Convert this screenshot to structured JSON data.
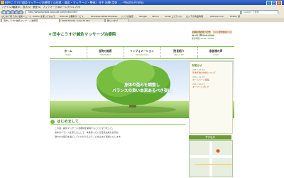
{
  "browser": {
    "title": "田中こうすけ鍼灸マッサージ治療院 | 山形県・鍼灸・マッサージ・整体 | 日中 治療 定休 ... - Mozilla Firefox",
    "menu": [
      "ファイル(F)",
      "編集(E)",
      "表示(V)",
      "履歴(S)",
      "ブックマーク(B)",
      "ツール(T)",
      "ヘルプ(H)"
    ],
    "url": "http://www.tanaka-kousuke.com/index.html",
    "search_placeholder": "Google で検索",
    "bookmarks": [
      "はじめて使う方に",
      "最新ニュース",
      "Firefox を使ってみよう",
      "Hotmail の無料サービス",
      "Windows Media",
      "Windows",
      "リンクの設定",
      "Google",
      "Yahoo!",
      "Sonet 上でサイト",
      "ロシアの商品情報",
      "Outlook.com",
      "Firefox 旅"
    ],
    "tabs": [
      "田中こうすけ鍼灸マッサージ治療院",
      "1000 Stories - Love To Win",
      "新しいタブ"
    ]
  },
  "site": {
    "logo": "田中こうすけ鍼灸マッサージ治療院",
    "contact_button": "お問い合わせ・ご予約",
    "access_button": "アクセス",
    "phone": "☎ 0123-000-0000",
    "hours": "受付時間 10:00〜20:00"
  },
  "nav": [
    {
      "ja": "ホーム",
      "en": "HOME"
    },
    {
      "ja": "当院の施術",
      "en": "TREATMENT"
    },
    {
      "ja": "インフォメーション",
      "en": "INFORMATION"
    },
    {
      "ja": "院長紹介",
      "en": "ABOUT ME"
    },
    {
      "ja": "患者様の声",
      "en": "VOICE"
    }
  ],
  "hero": {
    "caption_line1": "身体の歪みを調整し",
    "caption_line2": "バランスの良い本来あるべき姿に"
  },
  "sidebar": {
    "heading": "お知らせ",
    "items": [
      {
        "date": "2012.01.22",
        "title": "年末年始の休診について"
      },
      {
        "date": "2011.11.15",
        "title": "ホームページ開設"
      },
      {
        "date": "2011.10.01",
        "title": "オープンしました"
      }
    ]
  },
  "content": {
    "heading": "はじめまして",
    "paragraphs": [
      "この度、鍼灸マッサージ治療院を開院することになりました。",
      "身体のバランスを整えることで、本来持っている自然治癒力を高め、",
      "健やかな毎日を過ごしていただけるよう、心を込めて施術いたします。"
    ]
  },
  "colors": {
    "brand_green": "#3da53d",
    "nav_line": "#7fbf3a",
    "accent_orange": "#c05a1a"
  }
}
